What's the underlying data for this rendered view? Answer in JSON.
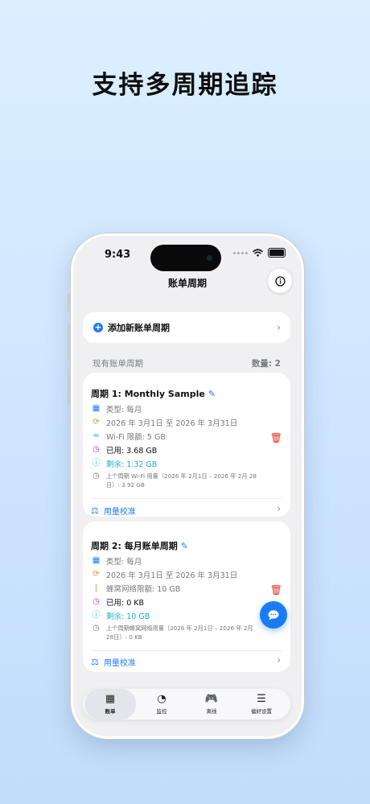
{
  "headline": "支持多周期追踪",
  "status_bar": {
    "time": "9:43"
  },
  "nav": {
    "title": "账单周期",
    "info_icon": "info-circle-icon"
  },
  "add_cycle": {
    "label": "添加新账单周期"
  },
  "section": {
    "title": "现有账单周期",
    "count": "数量: 2"
  },
  "cycles": [
    {
      "title": "周期 1: Monthly Sample",
      "type": "类型: 每月",
      "date_range": "2026 年 3月1日 至 2026 年 3月31日",
      "limit": "Wi-Fi 限额: 5 GB",
      "used": "已用: 3.68 GB",
      "remaining": "剩余: 1.32 GB",
      "previous": "上个周期 Wi-Fi 用量（2026 年 2月1日 – 2026 年 2月 28日）: 3.92 GB",
      "calibrate": "用量校准"
    },
    {
      "title": "周期 2: 每月账单周期",
      "type": "类型: 每月",
      "date_range": "2026 年 3月1日 至 2026 年 3月31日",
      "limit": "蜂窝网络限额: 10 GB",
      "used": "已用: 0 KB",
      "remaining": "剩余: 10 GB",
      "previous": "上个周期蜂窝网络用量（2026 年 2月1日 – 2026 年 2月 28日）: 0 KB",
      "calibrate": "用量校准"
    }
  ],
  "tabs": [
    {
      "label": "账单",
      "icon": "calendar-icon",
      "active": true
    },
    {
      "label": "监控",
      "icon": "gauge-icon",
      "active": false
    },
    {
      "label": "离线",
      "icon": "gamepad-icon",
      "active": false
    },
    {
      "label": "偏好设置",
      "icon": "sliders-icon",
      "active": false
    }
  ],
  "colors": {
    "accent": "#1a7cf5",
    "danger": "#e5332a",
    "teal": "#17b3c4",
    "purple": "#b03cd6",
    "orange": "#f08a1c"
  }
}
